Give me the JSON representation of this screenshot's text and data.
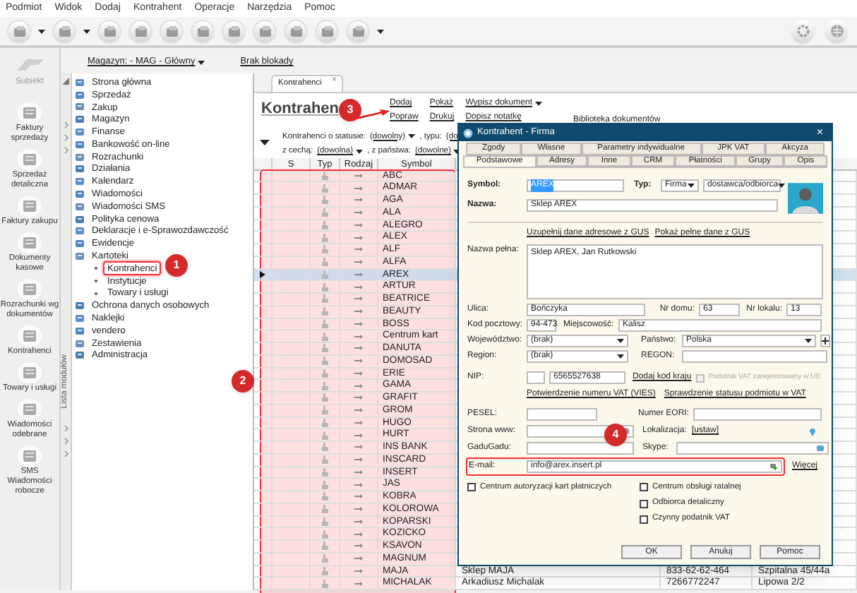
{
  "menu": [
    "Podmiot",
    "Widok",
    "Dodaj",
    "Kontrahent",
    "Operacje",
    "Narzędzia",
    "Pomoc"
  ],
  "logo": {
    "text": "Subiekt"
  },
  "context": {
    "warehouse": "Magazyn: - MAG - Główny",
    "lock": "Brak blokady"
  },
  "shortcuts": [
    {
      "label": "Faktury sprzedaży"
    },
    {
      "label": "Sprzedaż detaliczna"
    },
    {
      "label": "Faktury zakupu"
    },
    {
      "label": "Dokumenty kasowe"
    },
    {
      "label": "Rozrachunki wg dokumentów"
    },
    {
      "label": "Kontrahenci"
    },
    {
      "label": "Towary i usługi"
    },
    {
      "label": "Wiadomości odebrane"
    },
    {
      "label": "SMS Wiadomości robocze"
    }
  ],
  "module_panel": {
    "title": "Lista modułów",
    "items": [
      {
        "label": "Strona główna",
        "selected": false
      },
      {
        "label": "Sprzedaż",
        "selected": false
      },
      {
        "label": "Zakup",
        "selected": false
      },
      {
        "label": "Magazyn",
        "selected": false
      },
      {
        "label": "Finanse",
        "selected": false
      },
      {
        "label": "Bankowość on-line",
        "selected": false
      },
      {
        "label": "Rozrachunki",
        "selected": false
      },
      {
        "label": "Działania",
        "selected": false
      },
      {
        "label": "Kalendarz",
        "selected": false
      },
      {
        "label": "Wiadomości",
        "selected": false
      },
      {
        "label": "Wiadomości SMS",
        "selected": false
      },
      {
        "label": "Polityka cenowa",
        "selected": false
      },
      {
        "label": "Deklaracje i e-Sprawozdawczość",
        "selected": false
      },
      {
        "label": "Ewidencje",
        "selected": false
      },
      {
        "label": "Kartoteki",
        "selected": false,
        "expanded": true,
        "children": [
          {
            "label": "Kontrahenci",
            "selected": true
          },
          {
            "label": "Instytucje",
            "selected": false
          },
          {
            "label": "Towary i usługi",
            "selected": false
          }
        ]
      },
      {
        "label": "Ochrona danych osobowych",
        "selected": false
      },
      {
        "label": "Naklejki",
        "selected": false
      },
      {
        "label": "vendero",
        "selected": false
      },
      {
        "label": "Zestawienia",
        "selected": false
      },
      {
        "label": "Administracja",
        "selected": false
      }
    ]
  },
  "tabs": [
    {
      "label": "Kontrahenci",
      "selected": true,
      "close": "×"
    }
  ],
  "page": {
    "title": "Kontrahen",
    "action_columns": [
      {
        "items": [
          {
            "label": "Dodaj"
          },
          {
            "label": "Popraw"
          }
        ]
      },
      {
        "items": [
          {
            "label": "Pokaż"
          },
          {
            "label": "Drukuj"
          }
        ]
      },
      {
        "items": [
          {
            "label": "Wypisz dokument",
            "menu": true
          },
          {
            "label": "Dopisz notatkę"
          }
        ]
      },
      {
        "items": [
          {
            "label": "Biblioteka dokumentów"
          }
        ]
      }
    ]
  },
  "filters": [
    [
      {
        "kind": "text",
        "text": "Kontrahenci o statusie:"
      },
      {
        "kind": "dropdown",
        "text": "(dowolny)"
      },
      {
        "kind": "text",
        "text": ", typu:"
      },
      {
        "kind": "value",
        "text": "(do"
      }
    ],
    [
      {
        "kind": "text",
        "text": "z cechą:"
      },
      {
        "kind": "dropdown",
        "text": "(dowolna)"
      },
      {
        "kind": "text",
        "text": ", z państwa:"
      },
      {
        "kind": "dropdown",
        "text": "(dowolne)"
      }
    ]
  ],
  "table": {
    "columns": [
      "S",
      "Typ",
      "Rodzaj",
      "Symbol"
    ],
    "rows": [
      {
        "symbol": "ABC",
        "selected": false
      },
      {
        "symbol": "ADMAR",
        "selected": false
      },
      {
        "symbol": "AGA",
        "selected": false
      },
      {
        "symbol": "ALA",
        "selected": false
      },
      {
        "symbol": "ALEGRO",
        "selected": false
      },
      {
        "symbol": "ALEX",
        "selected": false
      },
      {
        "symbol": "ALF",
        "selected": false
      },
      {
        "symbol": "ALFA",
        "selected": false
      },
      {
        "symbol": "AREX",
        "selected": true
      },
      {
        "symbol": "ARTUR",
        "selected": false
      },
      {
        "symbol": "BEATRICE",
        "selected": false
      },
      {
        "symbol": "BEAUTY",
        "selected": false
      },
      {
        "symbol": "BOSS",
        "selected": false
      },
      {
        "symbol": "Centrum kart",
        "selected": false
      },
      {
        "symbol": "DANUTA",
        "selected": false
      },
      {
        "symbol": "DOMOSAD",
        "selected": false
      },
      {
        "symbol": "ERIE",
        "selected": false
      },
      {
        "symbol": "GAMA",
        "selected": false
      },
      {
        "symbol": "GRAFIT",
        "selected": false
      },
      {
        "symbol": "GROM",
        "selected": false
      },
      {
        "symbol": "HUGO",
        "selected": false
      },
      {
        "symbol": "HURT",
        "selected": false
      },
      {
        "symbol": "INS BANK",
        "selected": false
      },
      {
        "symbol": "INSCARD",
        "selected": false
      },
      {
        "symbol": "INSERT",
        "selected": false
      },
      {
        "symbol": "JAS",
        "selected": false
      },
      {
        "symbol": "KOBRA",
        "selected": false
      },
      {
        "symbol": "KOLOROWA",
        "selected": false
      },
      {
        "symbol": "KOPARSKI",
        "selected": false
      },
      {
        "symbol": "KOZICKO",
        "selected": false
      },
      {
        "symbol": "KSAVON",
        "selected": false
      },
      {
        "symbol": "MAGNUM",
        "selected": false
      },
      {
        "symbol": "MAJA",
        "selected": false,
        "column_5": "Sklep MAJA",
        "column_6": "833-62-62-464",
        "column_7": "Szpitalna  45/44a"
      },
      {
        "symbol": "MICHALAK",
        "selected": false,
        "column_5": "Arkadiusz Michalak",
        "column_6": "7266772247",
        "column_7": "Lipowa  2/2"
      }
    ]
  },
  "dialog": {
    "title": "Kontrahent - Firma",
    "close": "×",
    "tab_rows": [
      [
        {
          "label": "Zgody",
          "selected": false
        },
        {
          "label": "Własne",
          "selected": false
        },
        {
          "label": "Parametry indywidualne",
          "selected": false
        },
        {
          "label": "JPK VAT",
          "selected": false
        },
        {
          "label": "Akcyza",
          "selected": false
        }
      ],
      [
        {
          "label": "Podstawowe",
          "selected": true
        },
        {
          "label": "Adresy",
          "selected": false
        },
        {
          "label": "Inne",
          "selected": false
        },
        {
          "label": "CRM",
          "selected": false
        },
        {
          "label": "Płatności",
          "selected": false
        },
        {
          "label": "Grupy",
          "selected": false
        },
        {
          "label": "Opis",
          "selected": false
        }
      ]
    ],
    "symbol": {
      "label": "Symbol:",
      "value": "AREX"
    },
    "type": {
      "label": "Typ:",
      "value": "Firma"
    },
    "role": {
      "value": "dostawca/odbiorca"
    },
    "name": {
      "label": "Nazwa:",
      "value": "Sklep AREX"
    },
    "gus_links": [
      "Uzupełnij dane adresowe z GUS",
      "Pokaż pełne dane z GUS"
    ],
    "full_name": {
      "label": "Nazwa pełna:",
      "value": "Sklep AREX, Jan Rutkowski"
    },
    "street": {
      "label": "Ulica:",
      "value": "Bończyka"
    },
    "house_no": {
      "label": "Nr domu:",
      "value": "63"
    },
    "unit_no": {
      "label": "Nr lokalu:",
      "value": "13"
    },
    "postal_code": {
      "label": "Kod pocztowy:",
      "value": "94-473"
    },
    "city": {
      "label": "Miejscowość:",
      "value": "Kalisz"
    },
    "voivodeship": {
      "label": "Województwo:",
      "value": "(brak)"
    },
    "country": {
      "label": "Państwo:",
      "value": "Polska"
    },
    "region": {
      "label": "Region:",
      "value": "(brak)"
    },
    "regon": {
      "label": "REGON:"
    },
    "nip": {
      "label": "NIP:",
      "value": "6565527638"
    },
    "add_country_code": "Dodaj kod kraju",
    "eu_vat": {
      "label": "Podatnik VAT zarejestrowany w UE",
      "checked": false,
      "disabled": true
    },
    "vat_links": [
      "Potwierdzenie numeru VAT (VIES)",
      "Sprawdzenie statusu podmiotu w VAT"
    ],
    "pesel": {
      "label": "PESEL:"
    },
    "eori": {
      "label": "Numer EORI:"
    },
    "website": {
      "label": "Strona www:"
    },
    "location": {
      "label": "Lokalizacja:",
      "link": "[ustaw]"
    },
    "gadugadu": {
      "label": "GaduGadu:"
    },
    "skype": {
      "label": "Skype:"
    },
    "email": {
      "label": "E-mail:",
      "value": "info@arex.insert.pl"
    },
    "more": "Więcej",
    "checkboxes_left": [
      {
        "label": "Centrum autoryzacji kart płatniczych",
        "checked": false
      }
    ],
    "checkboxes_right": [
      {
        "label": "Centrum obsługi ratalnej",
        "checked": false
      },
      {
        "label": "Odbiorca detaliczny",
        "checked": false
      },
      {
        "label": "Czynny podatnik VAT",
        "checked": false
      }
    ],
    "buttons": [
      "OK",
      "Anuluj",
      "Pomoc"
    ]
  },
  "callouts": [
    "1",
    "2",
    "3",
    "4"
  ]
}
